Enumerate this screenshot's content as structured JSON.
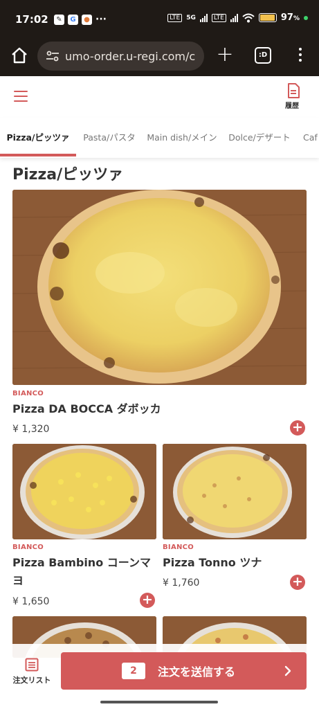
{
  "status": {
    "time": "17:02",
    "battery": "97",
    "battery_fill": 0.97,
    "net_label": "5G"
  },
  "browser": {
    "url": "umo-order.u-regi.com/c",
    "tabs_label": ":D"
  },
  "header": {
    "history_label": "履歴"
  },
  "tabs": [
    {
      "label": "Pizza/ピッツァ",
      "active": true
    },
    {
      "label": "Pasta/パスタ",
      "active": false
    },
    {
      "label": "Main dish/メイン",
      "active": false
    },
    {
      "label": "Dolce/デザート",
      "active": false
    },
    {
      "label": "Caf",
      "active": false
    }
  ],
  "section_title": "Pizza/ピッツァ",
  "products": [
    {
      "tag": "BIANCO",
      "name": "Pizza DA BOCCA ダボッカ",
      "price": "¥ 1,320"
    },
    {
      "tag": "BIANCO",
      "name": "Pizza Bambino コーンマヨ",
      "price": "¥ 1,650"
    },
    {
      "tag": "BIANCO",
      "name": "Pizza Tonno ツナ",
      "price": "¥ 1,760"
    }
  ],
  "bottom": {
    "order_list_label": "注文リスト",
    "count": "2",
    "submit_label": "注文を送信する"
  },
  "colors": {
    "accent": "#d35a5a",
    "browser_bg": "#1f1a16"
  }
}
